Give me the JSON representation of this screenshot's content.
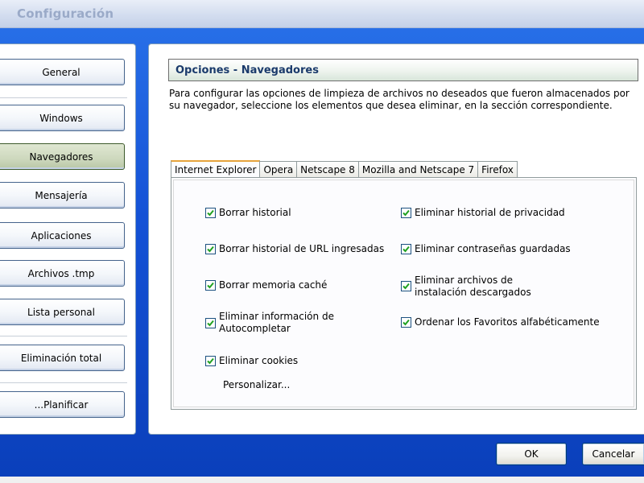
{
  "window": {
    "title": "Configuración"
  },
  "nav": {
    "items": [
      {
        "label": "General"
      },
      {
        "label": "Windows"
      },
      {
        "label": "Navegadores"
      },
      {
        "label": "Mensajería"
      },
      {
        "label": "Aplicaciones"
      },
      {
        "label": "Archivos .tmp"
      },
      {
        "label": "Lista personal"
      },
      {
        "label": "Eliminación total"
      },
      {
        "label": "...Planificar"
      }
    ],
    "active": "Navegadores"
  },
  "section": {
    "title": "Opciones - Navegadores",
    "description": "Para configurar las opciones de limpieza de archivos no deseados que fueron almacenados por su navegador, seleccione los elementos que desea eliminar, en la sección correspondiente."
  },
  "tabs": [
    {
      "label": "Internet Explorer"
    },
    {
      "label": "Opera"
    },
    {
      "label": "Netscape 8"
    },
    {
      "label": "Mozilla and Netscape 7"
    },
    {
      "label": "Firefox"
    }
  ],
  "active_tab": "Internet Explorer",
  "options_left": [
    {
      "label": "Borrar historial",
      "checked": true
    },
    {
      "label": "Borrar historial de URL ingresadas",
      "checked": true
    },
    {
      "label": "Borrar memoria caché",
      "checked": true
    },
    {
      "label": " Eliminar información de Autocompletar",
      "checked": true
    },
    {
      "label": "Eliminar cookies",
      "checked": true
    }
  ],
  "options_right": [
    {
      "label": "Eliminar historial de privacidad",
      "checked": true
    },
    {
      "label": "Eliminar contraseñas guardadas",
      "checked": true
    },
    {
      "label": " Eliminar archivos de instalación descargados",
      "checked": true
    },
    {
      "label": "Ordenar los Favoritos alfabéticamente",
      "checked": true
    }
  ],
  "customize_label": "Personalizar...",
  "buttons": {
    "ok": "OK",
    "cancel": "Cancelar"
  },
  "colors": {
    "frame": "#1452d6",
    "checkmark": "#21a121",
    "header_text": "#1a3a6b"
  }
}
